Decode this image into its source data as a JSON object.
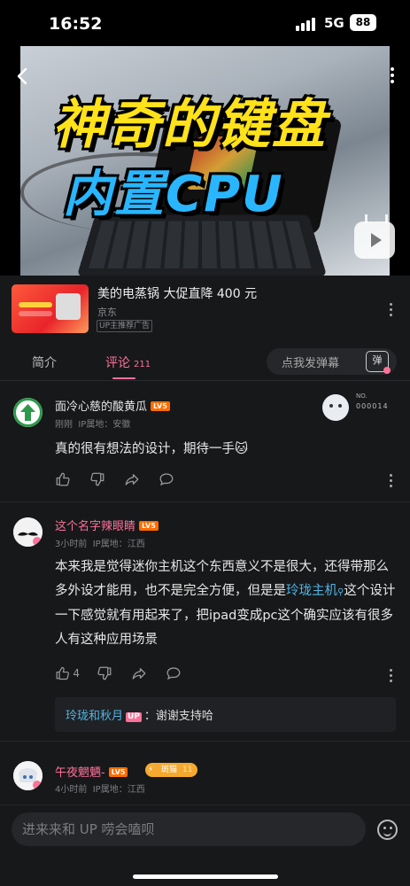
{
  "status_bar": {
    "time": "16:52",
    "network": "5G",
    "battery": "88"
  },
  "video": {
    "title_line1": "神奇的键盘",
    "title_line2": "内置CPU"
  },
  "ad": {
    "title": "美的电蒸锅 大促直降 400 元",
    "brand": "京东",
    "tag": "UP主推荐广告"
  },
  "tabs": {
    "intro": "简介",
    "comments": "评论",
    "comment_count": "211",
    "danmaku_placeholder": "点我发弹幕",
    "danmaku_button": "弹"
  },
  "comments": [
    {
      "username": "面冷心慈的酸黄瓜",
      "level": "LV5",
      "time": "刚刚",
      "location": "IP属地：安徽",
      "text": "真的很有想法的设计，期待一手🐱",
      "fan_card": {
        "label": "NO.",
        "number": "000014"
      }
    },
    {
      "username": "这个名字辣眼睛",
      "level": "LV5",
      "time": "3小时前",
      "location": "IP属地：江西",
      "text_before": "本来我是觉得迷你主机这个东西意义不是很大，还得带那么多外设才能用，也不是完全方便，但是是",
      "link": "玲珑主机",
      "text_after": "这个设计一下感觉就有用起来了，把ipad变成pc这个确实应该有很多人有这种应用场景",
      "likes": "4",
      "reply": {
        "author": "玲珑和秋月",
        "badge": "UP",
        "text": "：谢谢支持哈"
      }
    },
    {
      "username": "午夜魍魉-",
      "level": "LV5",
      "fan_badge": "斑猫",
      "fan_level": "11",
      "time": "4小时前",
      "location": "IP属地：江西"
    }
  ],
  "input": {
    "placeholder": "进来来和 UP 唠会嗑呗"
  },
  "colors": {
    "accent": "#fb7299",
    "link": "#4fb6e6",
    "level": "#ff6c00"
  }
}
